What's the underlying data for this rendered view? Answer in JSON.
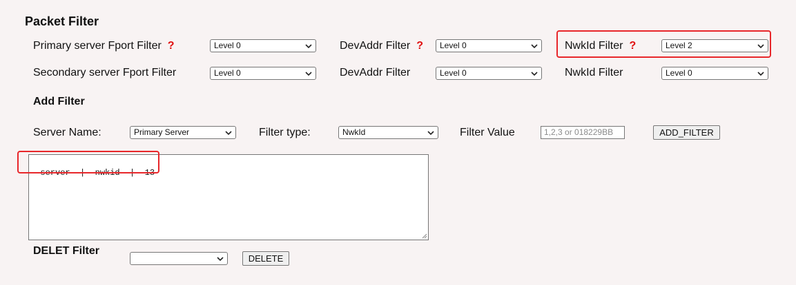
{
  "title": "Packet Filter",
  "rows": [
    {
      "fport_label": "Primary server Fport Filter",
      "fport_value": "Level 0",
      "devaddr_label": "DevAddr Filter",
      "devaddr_value": "Level 0",
      "nwkid_label": "NwkId Filter",
      "nwkid_value": "Level 2",
      "help_mark": "?"
    },
    {
      "fport_label": "Secondary server Fport Filter",
      "fport_value": "Level 0",
      "devaddr_label": "DevAddr Filter",
      "devaddr_value": "Level 0",
      "nwkid_label": "NwkId Filter",
      "nwkid_value": "Level 0"
    }
  ],
  "add_filter": {
    "heading": "Add Filter",
    "server_name_label": "Server Name:",
    "server_name_value": "Primary Server",
    "filter_type_label": "Filter type:",
    "filter_type_value": "NwkId",
    "filter_value_label": "Filter Value",
    "filter_value_placeholder": "1,2,3 or 018229BB",
    "add_button": "ADD_FILTER"
  },
  "filter_list_text": "server  |  nwkid  |  13",
  "delete_filter": {
    "heading": "DELET Filter",
    "select_value": "",
    "delete_button": "DELETE"
  },
  "colors": {
    "highlight": "#e8262a",
    "help_mark": "#e01010",
    "background": "#f8f3f3"
  }
}
